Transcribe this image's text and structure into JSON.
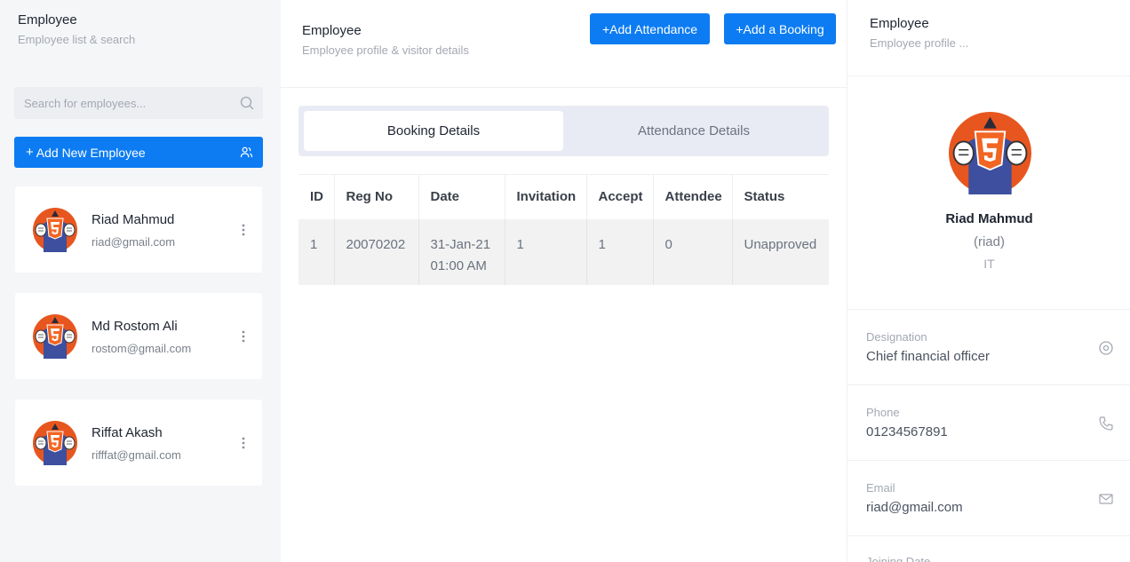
{
  "left": {
    "title": "Employee",
    "subtitle": "Employee list & search",
    "search_placeholder": "Search for employees...",
    "add_button": "Add New Employee",
    "employees": [
      {
        "name": "Riad Mahmud",
        "email": "riad@gmail.com"
      },
      {
        "name": "Md Rostom Ali",
        "email": "rostom@gmail.com"
      },
      {
        "name": "Riffat Akash",
        "email": "rifffat@gmail.com"
      }
    ]
  },
  "middle": {
    "title": "Employee",
    "subtitle": "Employee profile & visitor details",
    "add_attendance": "Add Attendance",
    "add_booking": "Add a Booking",
    "tabs": [
      "Booking Details",
      "Attendance Details"
    ],
    "columns": [
      "ID",
      "Reg No",
      "Date",
      "Invitation",
      "Accept",
      "Attendee",
      "Status"
    ],
    "rows": [
      {
        "id": "1",
        "reg_no": "20070202",
        "date": "31-Jan-21",
        "time": "01:00 AM",
        "invitation": "1",
        "accept": "1",
        "attendee": "0",
        "status": "Unapproved"
      }
    ]
  },
  "right": {
    "title": "Employee",
    "subtitle": "Employee profile ...",
    "name": "Riad Mahmud",
    "username": "(riad)",
    "department": "IT",
    "designation_label": "Designation",
    "designation": "Chief financial officer",
    "phone_label": "Phone",
    "phone": "01234567891",
    "email_label": "Email",
    "email": "riad@gmail.com",
    "joining_label": "Joining Date"
  },
  "colors": {
    "primary": "#0d7cf2",
    "avatar_bg": "#e8561f",
    "avatar_figure": "#3d4f9e"
  }
}
